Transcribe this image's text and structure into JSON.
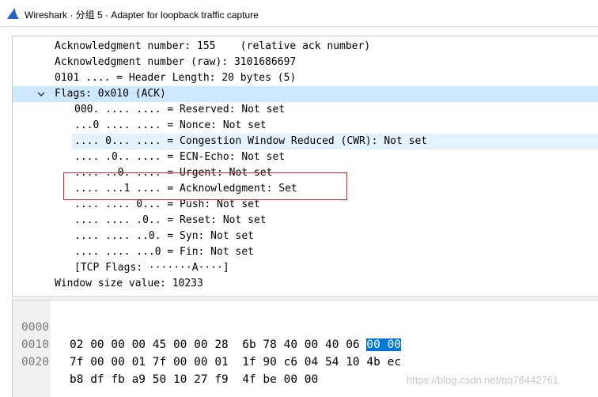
{
  "window": {
    "title": "Wireshark · 分组 5 · Adapter for loopback traffic capture",
    "accent_color": "#1e64c8"
  },
  "detail_tree": {
    "rows": [
      "Acknowledgment number: 155    (relative ack number)",
      "Acknowledgment number (raw): 3101686697",
      "0101 .... = Header Length: 20 bytes (5)",
      "Flags: 0x010 (ACK)",
      "000. .... .... = Reserved: Not set",
      "...0 .... .... = Nonce: Not set",
      ".... 0... .... = Congestion Window Reduced (CWR): Not set",
      ".... .0.. .... = ECN-Echo: Not set",
      ".... ..0. .... = Urgent: Not set",
      ".... ...1 .... = Acknowledgment: Set",
      ".... .... 0... = Push: Not set",
      ".... .... .0.. = Reset: Not set",
      ".... .... ..0. = Syn: Not set",
      ".... .... ...0 = Fin: Not set",
      "[TCP Flags: ·······A····]",
      "Window size value: 10233"
    ],
    "selected_row": "Flags: 0x010 (ACK)",
    "selected_color": "#cde8ff",
    "hover_color": "#e5f3ff",
    "annotation_color": "#d9262c"
  },
  "bytes_pane": {
    "rows": [
      {
        "offset": "0000",
        "bytes_plain": "02 00 00 00 45 00 00 28  6b 78 40 00 40 06 ",
        "bytes_selected": "00 00"
      },
      {
        "offset": "0010",
        "bytes_plain": "7f 00 00 01 7f 00 00 01  1f 90 c6 04 54 10 4b ec",
        "bytes_selected": ""
      },
      {
        "offset": "0020",
        "bytes_plain": "b8 df fb a9 50 10 27 f9  4f be 00 00",
        "bytes_selected": ""
      }
    ],
    "selection_color": "#0078d7"
  },
  "watermark": "https://blog.csdn.net/qq78442761"
}
